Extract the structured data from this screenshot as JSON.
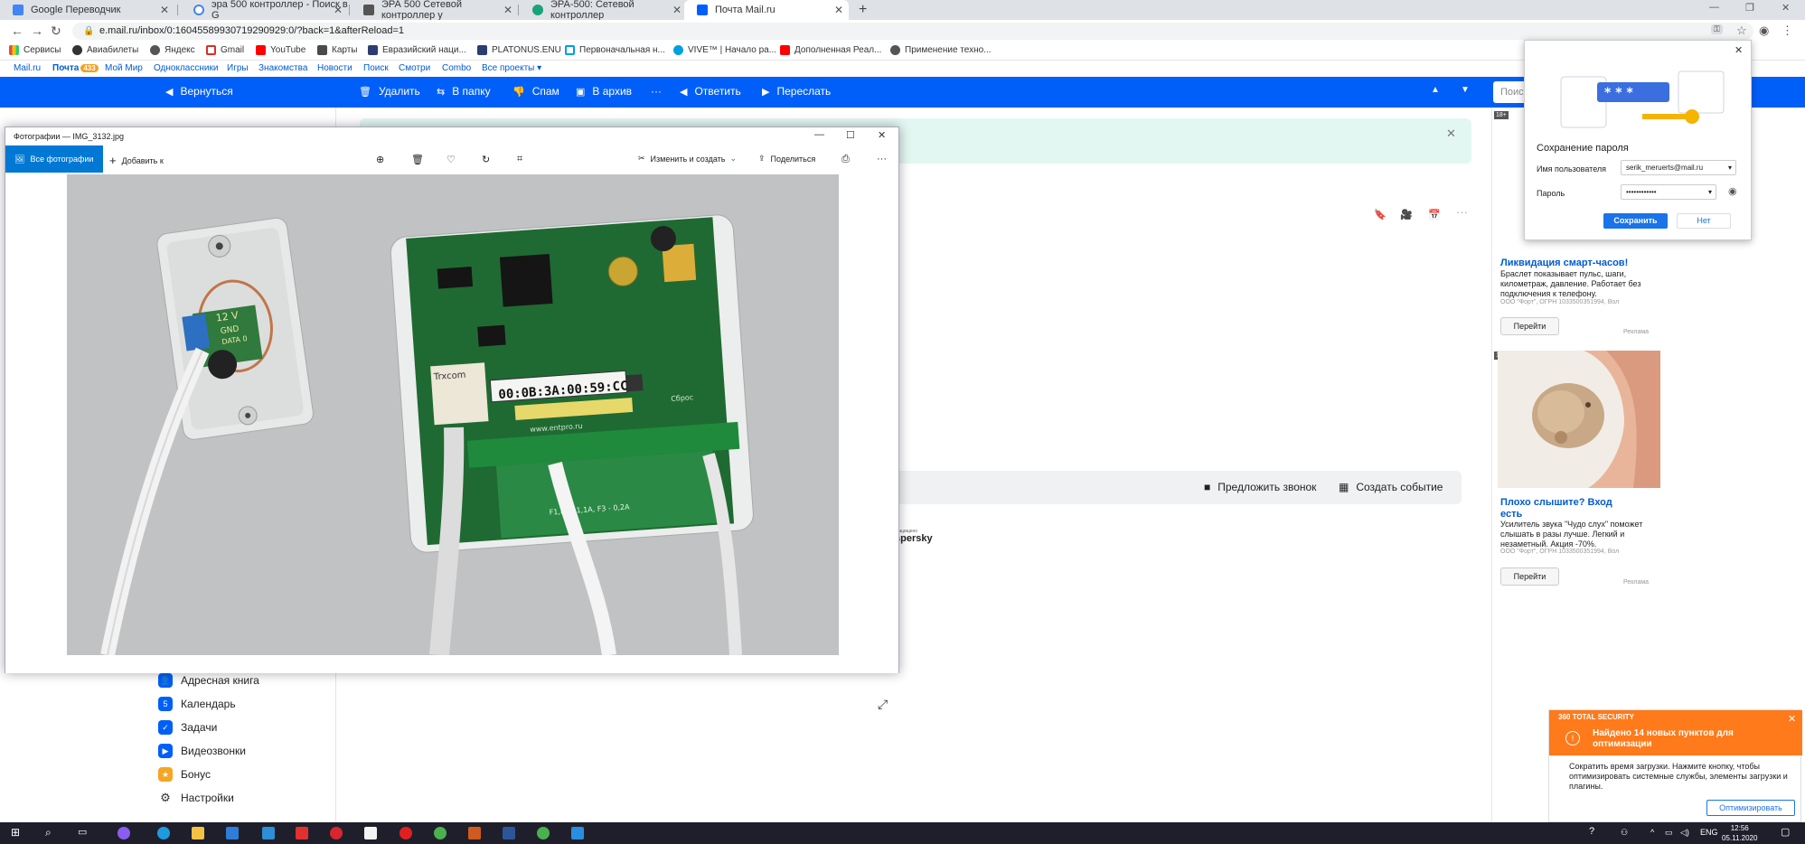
{
  "browser": {
    "tabs": [
      {
        "title": "Google Переводчик",
        "color": "#4285f4"
      },
      {
        "title": "эра 500 контроллер - Поиск в G",
        "color": "#4285f4"
      },
      {
        "title": "ЭРА 500 Сетевой контроллер у",
        "color": "#555555"
      },
      {
        "title": "ЭРА-500: Сетевой контроллер",
        "color": "#1aa37a"
      },
      {
        "title": "Почта Mail.ru",
        "color": "#005ff9"
      }
    ],
    "new_tab": "+",
    "url": "e.mail.ru/inbox/0:16045589930719290929:0/?back=1&afterReload=1",
    "bookmarks": [
      {
        "label": "Сервисы",
        "color": "#e74c3c"
      },
      {
        "label": "Авиабилеты",
        "color": "#333333"
      },
      {
        "label": "Яндекс",
        "color": "#555555"
      },
      {
        "label": "Gmail",
        "color": "#d93025"
      },
      {
        "label": "YouTube",
        "color": "#ff0000"
      },
      {
        "label": "Карты",
        "color": "#4a4a4a"
      },
      {
        "label": "Евразийский наци...",
        "color": "#2c3e70"
      },
      {
        "label": "PLATONUS.ENU",
        "color": "#2c3e70"
      },
      {
        "label": "Первоначальная н...",
        "color": "#00a0e0"
      },
      {
        "label": "VIVE™ | Начало ра...",
        "color": "#00a0e0"
      },
      {
        "label": "Дополненная Реал...",
        "color": "#ff0000"
      },
      {
        "label": "Применение техно...",
        "color": "#555555"
      }
    ]
  },
  "mail": {
    "topnav": [
      "Mail.ru",
      "Почта",
      "Мой Мир",
      "Одноклассники",
      "Игры",
      "Знакомства",
      "Новости",
      "Поиск",
      "Смотри",
      "Combo",
      "Все проекты ▾"
    ],
    "badge": "433",
    "toolbar": {
      "back": "Вернуться",
      "delete": "Удалить",
      "to_folder": "В папку",
      "spam": "Спам",
      "archive": "В архив",
      "more": "···",
      "reply": "Ответить",
      "forward": "Переслать",
      "search_placeholder": "Поис"
    },
    "folders": [
      {
        "label": "Адресная книга",
        "icon": "👤"
      },
      {
        "label": "Календарь",
        "icon": "5"
      },
      {
        "label": "Задачи",
        "icon": "✓"
      },
      {
        "label": "Видеозвонки",
        "icon": "▶"
      },
      {
        "label": "Бонус",
        "icon": "★"
      },
      {
        "label": "Настройки",
        "icon": "⚙"
      }
    ],
    "call_suggest": "Предложить звонок",
    "create_event": "Создать событие",
    "kaspersky_small": "Защищено",
    "kaspersky": "spersky"
  },
  "ads": [
    {
      "age": "18+",
      "title": "Ликвидация смарт-часов!",
      "text": "Браслет показывает пульс, шаги, километраж, давление. Работает без подключения к телефону.",
      "org": "ООО \"Форт\", ОГРН 1033500351994, Вол",
      "button": "Перейти",
      "label": "Реклама"
    },
    {
      "age": "18+",
      "title": "Плохо слышите? Вход есть",
      "text": "Усилитель звука \"Чудо слух\" поможет слышать в разы лучше. Легкий и незаметный. Акция -70%.",
      "org": "ООО \"Форт\", ОГРН 1033500351994, Вол",
      "button": "Перейти",
      "label": "Реклама"
    }
  ],
  "photos": {
    "title": "Фотографии — IMG_3132.jpg",
    "all_photos": "Все фотографии",
    "add_to": "Добавить к",
    "edit_create": "Изменить и создать",
    "share": "Поделиться",
    "more": "···",
    "label_mac": "00:0B:3A:00:59:CC",
    "label_brand": "Trxcom",
    "label_site": "www.entpro.ru",
    "label_reset": "Сброс",
    "label_power": "12 V",
    "label_gnd": "GND",
    "label_data": "DATA 0",
    "label_fuse": "F1,F2 - 1,1A, F3 - 0,2A"
  },
  "password_popup": {
    "title": "Сохранение пароля",
    "username_label": "Имя пользователя",
    "username_value": "serik_meruerts@mail.ru",
    "password_label": "Пароль",
    "password_value": "••••••••••••",
    "save": "Сохранить",
    "no": "Нет",
    "stars": "* * *"
  },
  "toast": {
    "brand": "360 TOTAL SECURITY",
    "title": "Найдено 14 новых пунктов для оптимизации",
    "body": "Сократить время загрузки. Нажмите кнопку, чтобы оптимизировать системные службы, элементы загрузки и плагины.",
    "button": "Оптимизировать"
  },
  "taskbar": {
    "lang": "ENG",
    "time": "12:56",
    "date": "05.11.2020"
  }
}
